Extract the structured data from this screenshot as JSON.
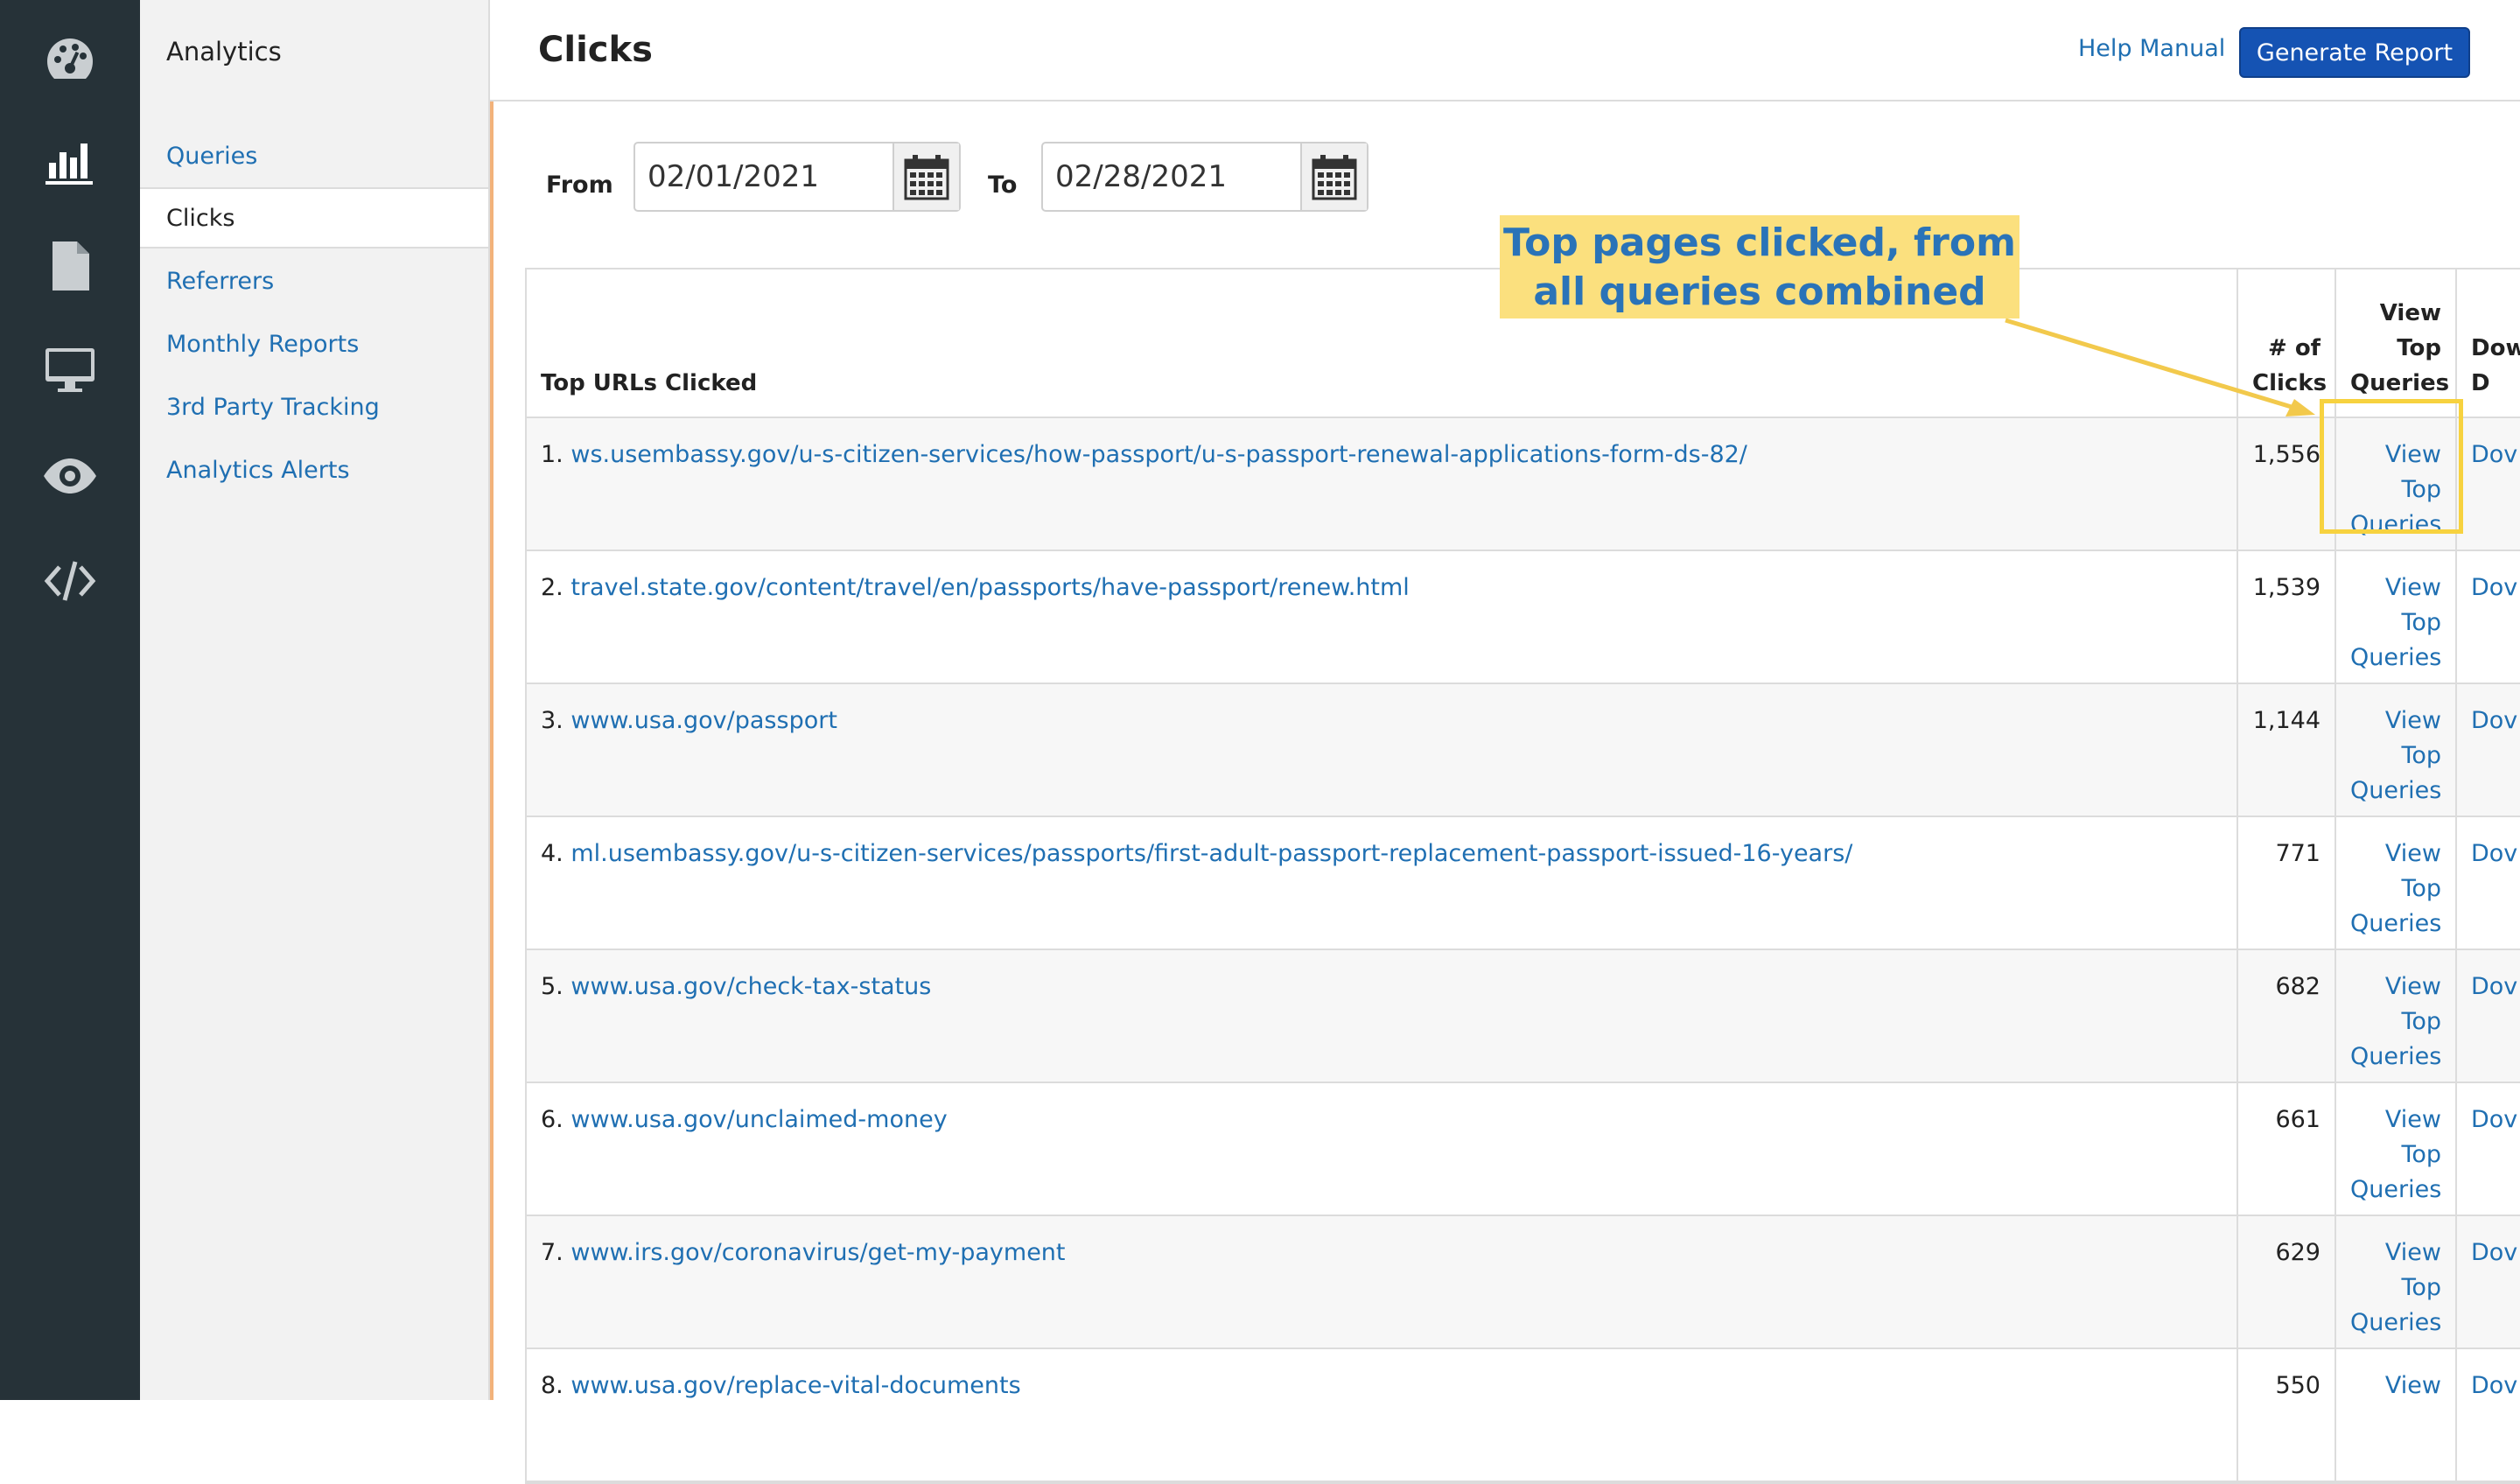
{
  "rail": {
    "icons": [
      "dashboard-icon",
      "bar-chart-icon",
      "document-icon",
      "monitor-icon",
      "eye-icon",
      "code-icon"
    ]
  },
  "subnav": {
    "title": "Analytics",
    "items": [
      {
        "label": "Queries",
        "active": false
      },
      {
        "label": "Clicks",
        "active": true
      },
      {
        "label": "Referrers",
        "active": false
      },
      {
        "label": "Monthly Reports",
        "active": false
      },
      {
        "label": "3rd Party Tracking",
        "active": false
      },
      {
        "label": "Analytics Alerts",
        "active": false
      }
    ]
  },
  "header": {
    "title": "Clicks",
    "help_label": "Help Manual",
    "generate_label": "Generate Report"
  },
  "filters": {
    "from_label": "From",
    "from_value": "02/01/2021",
    "to_label": "To",
    "to_value": "02/28/2021"
  },
  "table": {
    "headers": {
      "url": "Top URLs Clicked",
      "clicks": "# of Clicks",
      "view": "View Top Queries",
      "download": "Dow D"
    },
    "rows": [
      {
        "rank": "1.",
        "url": "ws.usembassy.gov/u-s-citizen-services/how-passport/u-s-passport-renewal-applications-form-ds-82/",
        "clicks": "1,556",
        "view": "View Top Queries",
        "download": "Dov"
      },
      {
        "rank": "2.",
        "url": "travel.state.gov/content/travel/en/passports/have-passport/renew.html",
        "clicks": "1,539",
        "view": "View Top Queries",
        "download": "Dov"
      },
      {
        "rank": "3.",
        "url": "www.usa.gov/passport",
        "clicks": "1,144",
        "view": "View Top Queries",
        "download": "Dov"
      },
      {
        "rank": "4.",
        "url": "ml.usembassy.gov/u-s-citizen-services/passports/first-adult-passport-replacement-passport-issued-16-years/",
        "clicks": "771",
        "view": "View Top Queries",
        "download": "Dov"
      },
      {
        "rank": "5.",
        "url": "www.usa.gov/check-tax-status",
        "clicks": "682",
        "view": "View Top Queries",
        "download": "Dov"
      },
      {
        "rank": "6.",
        "url": "www.usa.gov/unclaimed-money",
        "clicks": "661",
        "view": "View Top Queries",
        "download": "Dov"
      },
      {
        "rank": "7.",
        "url": "www.irs.gov/coronavirus/get-my-payment",
        "clicks": "629",
        "view": "View Top Queries",
        "download": "Dov"
      },
      {
        "rank": "8.",
        "url": "www.usa.gov/replace-vital-documents",
        "clicks": "550",
        "view": "View",
        "download": "Dov"
      }
    ]
  },
  "annotation": {
    "callout_line1": "Top pages clicked, from",
    "callout_line2": "all queries combined",
    "callout_bg": "#fbe07e",
    "callout_text_color": "#2a73b8",
    "highlight_color": "#f7d23f"
  },
  "colors": {
    "rail_bg": "#263238",
    "link": "#1f6fb2",
    "primary_button": "#1553b3",
    "content_border": "#f2b27a"
  }
}
